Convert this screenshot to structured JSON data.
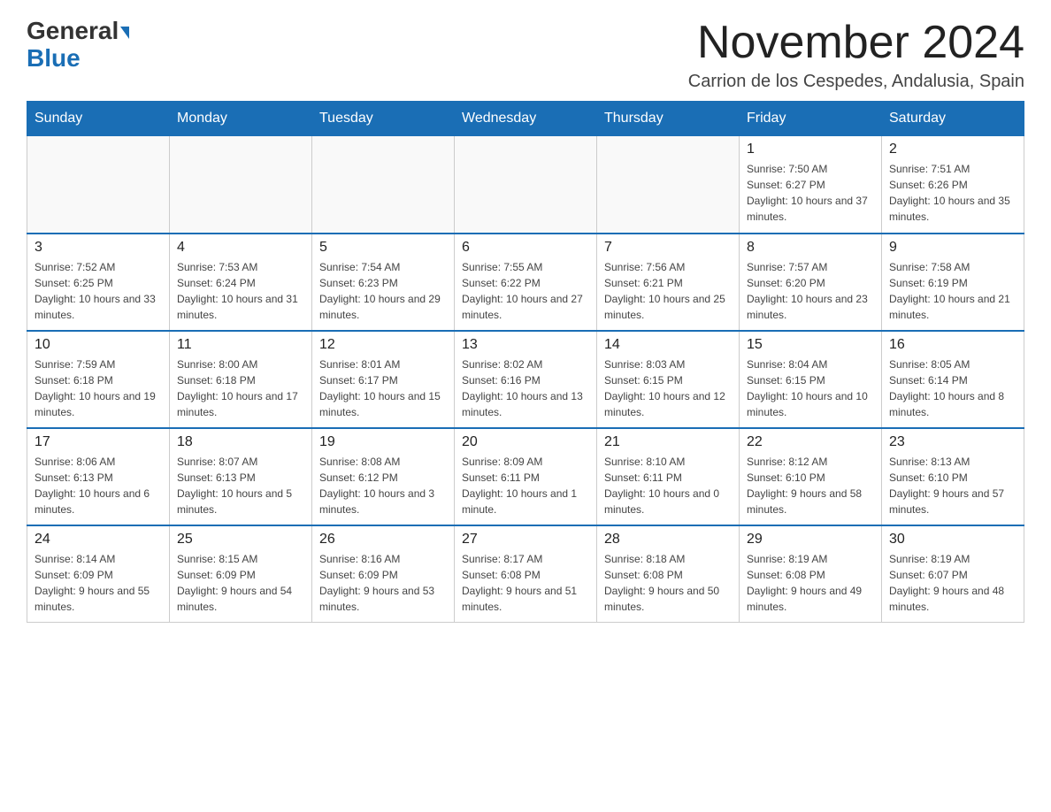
{
  "header": {
    "logo_line1": "General",
    "logo_line2": "Blue",
    "title": "November 2024",
    "subtitle": "Carrion de los Cespedes, Andalusia, Spain"
  },
  "weekdays": [
    "Sunday",
    "Monday",
    "Tuesday",
    "Wednesday",
    "Thursday",
    "Friday",
    "Saturday"
  ],
  "weeks": [
    [
      {
        "day": "",
        "info": ""
      },
      {
        "day": "",
        "info": ""
      },
      {
        "day": "",
        "info": ""
      },
      {
        "day": "",
        "info": ""
      },
      {
        "day": "",
        "info": ""
      },
      {
        "day": "1",
        "info": "Sunrise: 7:50 AM\nSunset: 6:27 PM\nDaylight: 10 hours and 37 minutes."
      },
      {
        "day": "2",
        "info": "Sunrise: 7:51 AM\nSunset: 6:26 PM\nDaylight: 10 hours and 35 minutes."
      }
    ],
    [
      {
        "day": "3",
        "info": "Sunrise: 7:52 AM\nSunset: 6:25 PM\nDaylight: 10 hours and 33 minutes."
      },
      {
        "day": "4",
        "info": "Sunrise: 7:53 AM\nSunset: 6:24 PM\nDaylight: 10 hours and 31 minutes."
      },
      {
        "day": "5",
        "info": "Sunrise: 7:54 AM\nSunset: 6:23 PM\nDaylight: 10 hours and 29 minutes."
      },
      {
        "day": "6",
        "info": "Sunrise: 7:55 AM\nSunset: 6:22 PM\nDaylight: 10 hours and 27 minutes."
      },
      {
        "day": "7",
        "info": "Sunrise: 7:56 AM\nSunset: 6:21 PM\nDaylight: 10 hours and 25 minutes."
      },
      {
        "day": "8",
        "info": "Sunrise: 7:57 AM\nSunset: 6:20 PM\nDaylight: 10 hours and 23 minutes."
      },
      {
        "day": "9",
        "info": "Sunrise: 7:58 AM\nSunset: 6:19 PM\nDaylight: 10 hours and 21 minutes."
      }
    ],
    [
      {
        "day": "10",
        "info": "Sunrise: 7:59 AM\nSunset: 6:18 PM\nDaylight: 10 hours and 19 minutes."
      },
      {
        "day": "11",
        "info": "Sunrise: 8:00 AM\nSunset: 6:18 PM\nDaylight: 10 hours and 17 minutes."
      },
      {
        "day": "12",
        "info": "Sunrise: 8:01 AM\nSunset: 6:17 PM\nDaylight: 10 hours and 15 minutes."
      },
      {
        "day": "13",
        "info": "Sunrise: 8:02 AM\nSunset: 6:16 PM\nDaylight: 10 hours and 13 minutes."
      },
      {
        "day": "14",
        "info": "Sunrise: 8:03 AM\nSunset: 6:15 PM\nDaylight: 10 hours and 12 minutes."
      },
      {
        "day": "15",
        "info": "Sunrise: 8:04 AM\nSunset: 6:15 PM\nDaylight: 10 hours and 10 minutes."
      },
      {
        "day": "16",
        "info": "Sunrise: 8:05 AM\nSunset: 6:14 PM\nDaylight: 10 hours and 8 minutes."
      }
    ],
    [
      {
        "day": "17",
        "info": "Sunrise: 8:06 AM\nSunset: 6:13 PM\nDaylight: 10 hours and 6 minutes."
      },
      {
        "day": "18",
        "info": "Sunrise: 8:07 AM\nSunset: 6:13 PM\nDaylight: 10 hours and 5 minutes."
      },
      {
        "day": "19",
        "info": "Sunrise: 8:08 AM\nSunset: 6:12 PM\nDaylight: 10 hours and 3 minutes."
      },
      {
        "day": "20",
        "info": "Sunrise: 8:09 AM\nSunset: 6:11 PM\nDaylight: 10 hours and 1 minute."
      },
      {
        "day": "21",
        "info": "Sunrise: 8:10 AM\nSunset: 6:11 PM\nDaylight: 10 hours and 0 minutes."
      },
      {
        "day": "22",
        "info": "Sunrise: 8:12 AM\nSunset: 6:10 PM\nDaylight: 9 hours and 58 minutes."
      },
      {
        "day": "23",
        "info": "Sunrise: 8:13 AM\nSunset: 6:10 PM\nDaylight: 9 hours and 57 minutes."
      }
    ],
    [
      {
        "day": "24",
        "info": "Sunrise: 8:14 AM\nSunset: 6:09 PM\nDaylight: 9 hours and 55 minutes."
      },
      {
        "day": "25",
        "info": "Sunrise: 8:15 AM\nSunset: 6:09 PM\nDaylight: 9 hours and 54 minutes."
      },
      {
        "day": "26",
        "info": "Sunrise: 8:16 AM\nSunset: 6:09 PM\nDaylight: 9 hours and 53 minutes."
      },
      {
        "day": "27",
        "info": "Sunrise: 8:17 AM\nSunset: 6:08 PM\nDaylight: 9 hours and 51 minutes."
      },
      {
        "day": "28",
        "info": "Sunrise: 8:18 AM\nSunset: 6:08 PM\nDaylight: 9 hours and 50 minutes."
      },
      {
        "day": "29",
        "info": "Sunrise: 8:19 AM\nSunset: 6:08 PM\nDaylight: 9 hours and 49 minutes."
      },
      {
        "day": "30",
        "info": "Sunrise: 8:19 AM\nSunset: 6:07 PM\nDaylight: 9 hours and 48 minutes."
      }
    ]
  ]
}
